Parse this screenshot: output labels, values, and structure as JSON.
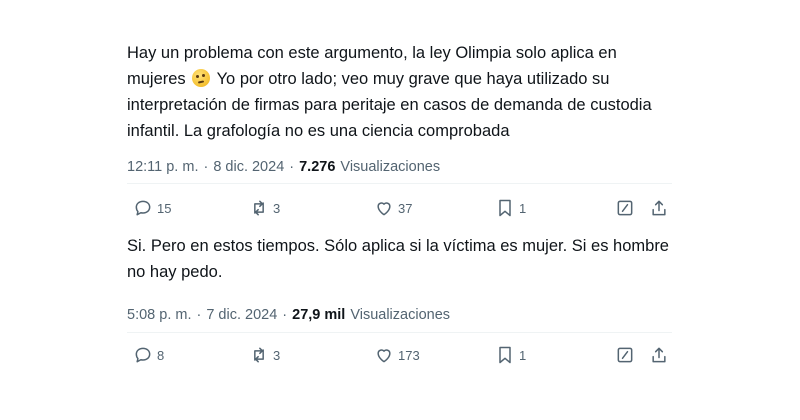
{
  "tweets": [
    {
      "text_part1": "Hay un problema con este argumento, la ley Olimpia solo aplica en mujeres ",
      "emoji": "face-with-rolling-eyes",
      "text_part2": " Yo por otro lado; veo muy grave que haya utilizado su interpretación de firmas para peritaje en casos de demanda de custodia infantil. La grafología no es una ciencia comprobada",
      "time": "12:11 p. m.",
      "sep": "·",
      "date": "8 dic. 2024",
      "views_count": "7.276",
      "views_label": "Visualizaciones",
      "replies": "15",
      "reposts": "3",
      "likes": "37",
      "bookmarks": "1"
    },
    {
      "text": "Si. Pero en estos tiempos. Sólo aplica si la víctima es mujer. Si es hombre no hay pedo.",
      "time": "5:08 p. m.",
      "sep": "·",
      "date": "7 dic. 2024",
      "views_count": "27,9 mil",
      "views_label": "Visualizaciones",
      "replies": "8",
      "reposts": "3",
      "likes": "173",
      "bookmarks": "1"
    }
  ],
  "icons": [
    "reply-icon",
    "repost-icon",
    "like-icon",
    "bookmark-icon",
    "grok-icon",
    "share-icon"
  ],
  "colors": {
    "text": "#0f1419",
    "muted": "#536471",
    "divider": "#eff3f4"
  }
}
